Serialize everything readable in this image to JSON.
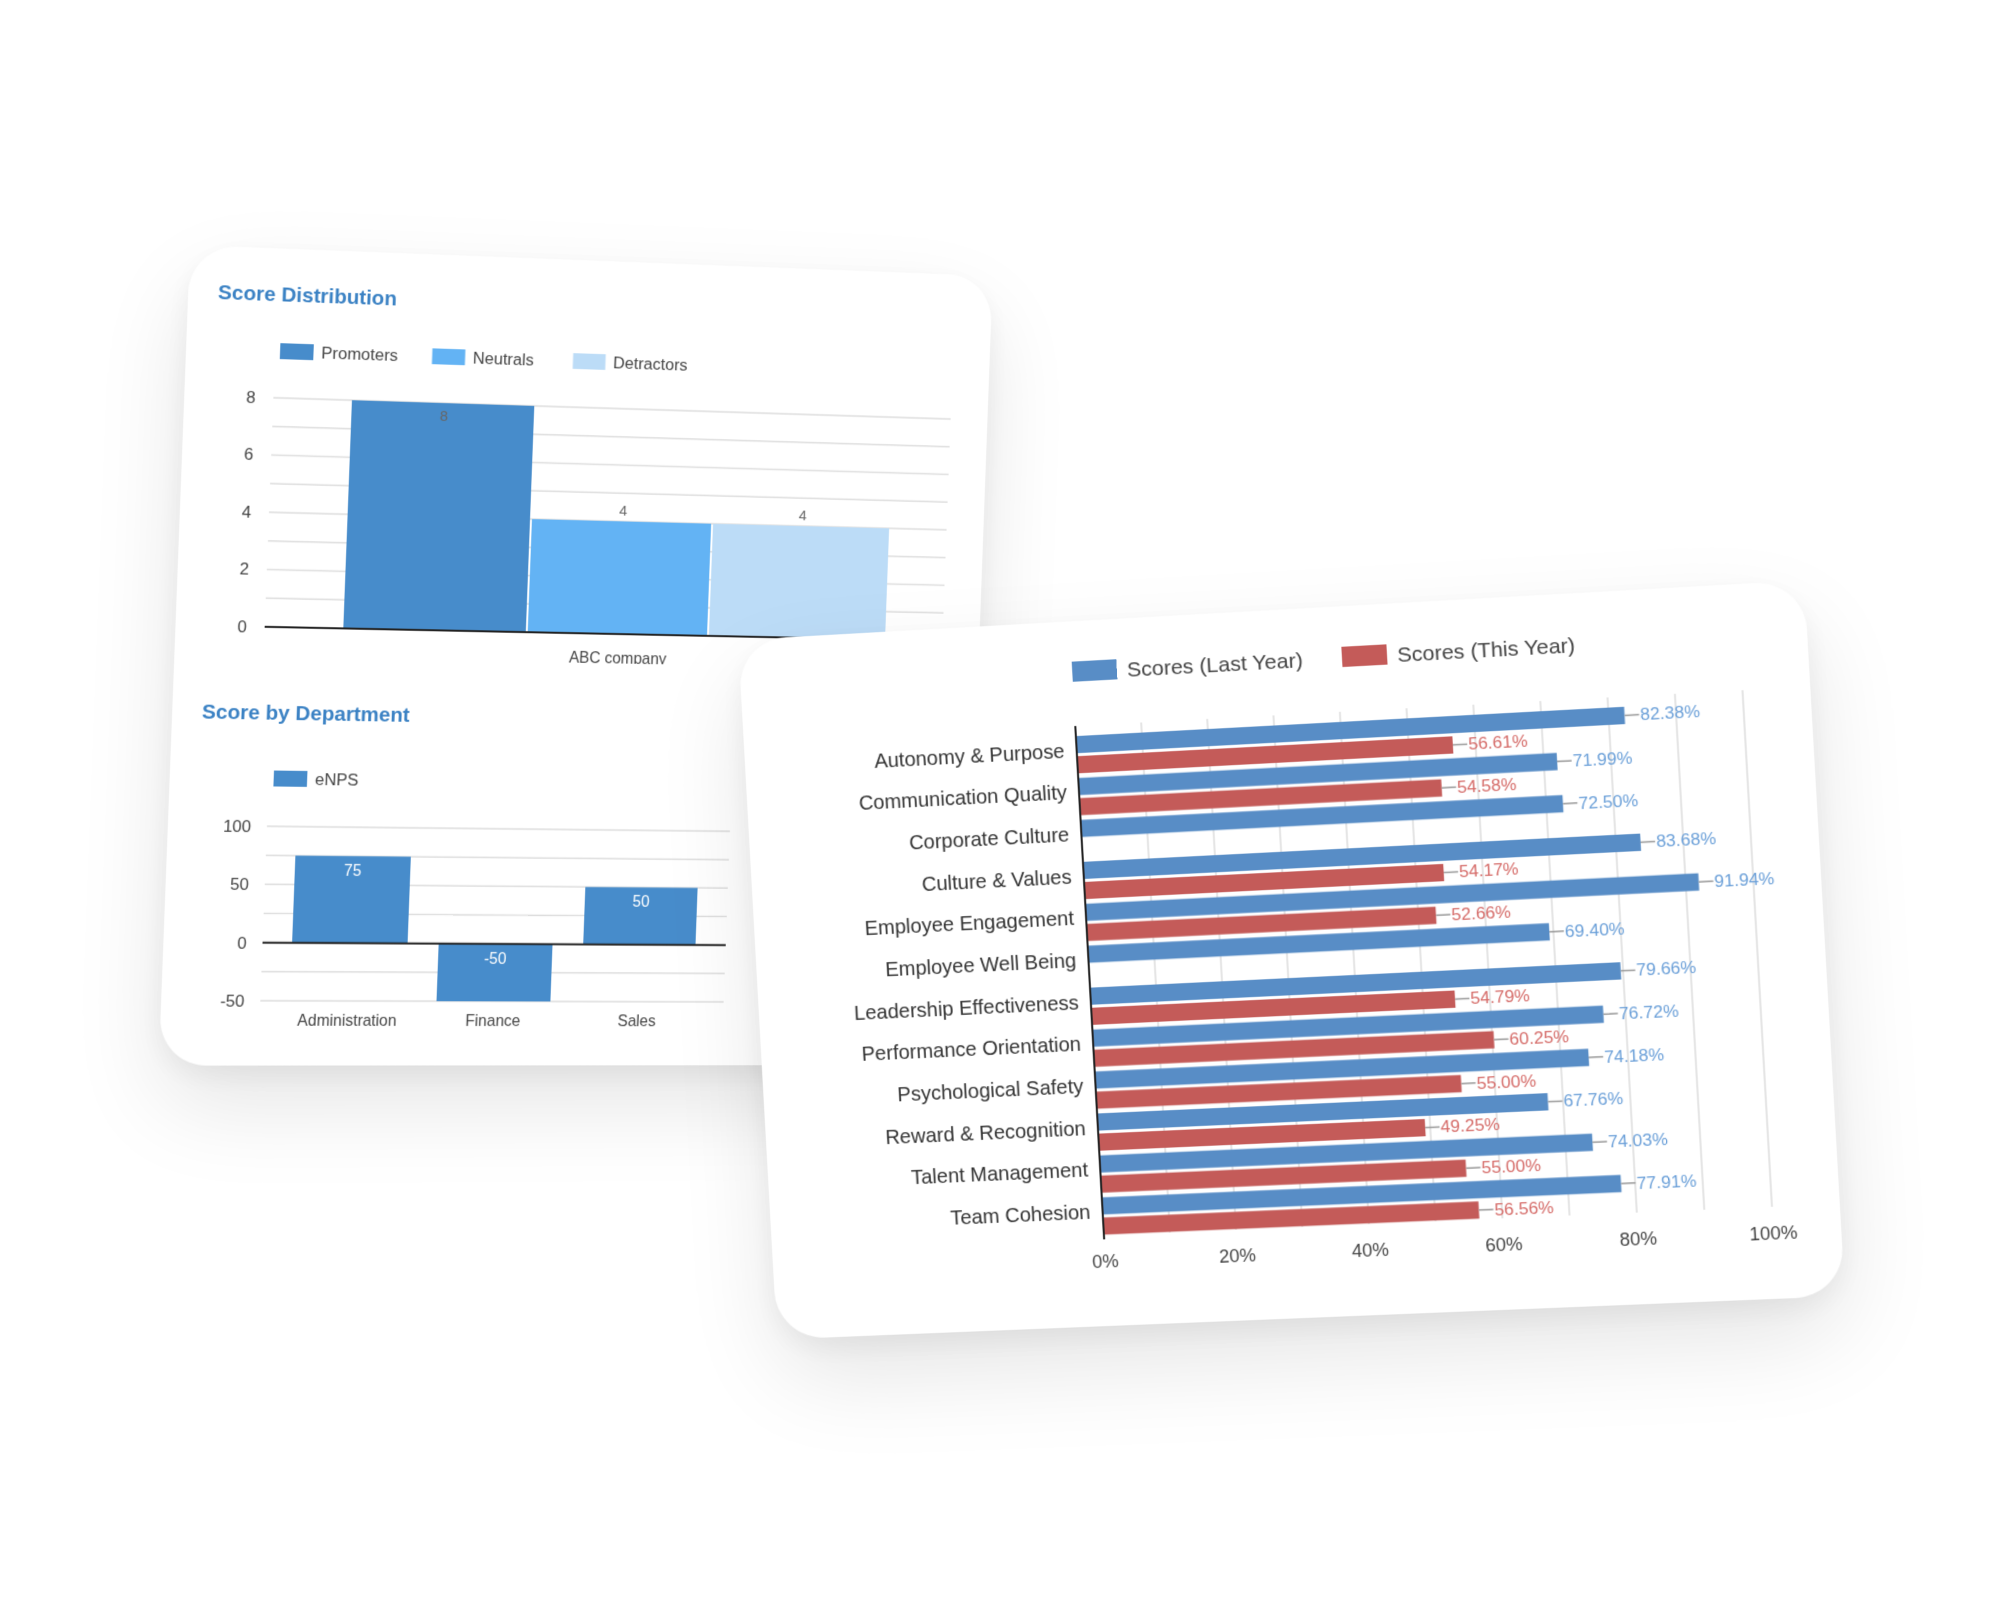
{
  "colors": {
    "promoters": "#478ccb",
    "neutrals": "#63b3f4",
    "detractors": "#bcdcf7",
    "enps": "#478ccb",
    "last_year": "#588dc6",
    "this_year": "#c45b59",
    "title": "#3b82c4",
    "axis_text": "#444444",
    "grid": "#dddddd"
  },
  "chart_data": [
    {
      "type": "bar",
      "title": "Score Distribution",
      "categories": [
        "ABC company"
      ],
      "series": [
        {
          "name": "Promoters",
          "values": [
            8
          ]
        },
        {
          "name": "Neutrals",
          "values": [
            4
          ]
        },
        {
          "name": "Detractors",
          "values": [
            4
          ]
        }
      ],
      "data_labels": [
        "8",
        "4",
        "4"
      ],
      "ylim": [
        0,
        8
      ],
      "yticks": [
        "0",
        "2",
        "4",
        "6",
        "8"
      ],
      "xlabel": "",
      "ylabel": "",
      "grid": true,
      "legend": "top-left"
    },
    {
      "type": "bar",
      "title": "Score by Department",
      "categories": [
        "Administration",
        "Finance",
        "Sales"
      ],
      "series": [
        {
          "name": "eNPS",
          "values": [
            75,
            -50,
            50
          ]
        }
      ],
      "data_labels": [
        "75",
        "-50",
        "50"
      ],
      "ylim": [
        -50,
        100
      ],
      "yticks": [
        "-50",
        "0",
        "50",
        "100"
      ],
      "xlabel": "",
      "ylabel": "",
      "grid": true,
      "legend": "top-left"
    },
    {
      "type": "bar",
      "orientation": "horizontal",
      "title": "",
      "categories": [
        "Autonomy & Purpose",
        "Communication Quality",
        "Corporate Culture",
        "Culture & Values",
        "Employee Engagement",
        "Employee Well Being",
        "Leadership Effectiveness",
        "Performance Orientation",
        "Psychological Safety",
        "Reward & Recognition",
        "Talent Management",
        "Team Cohesion"
      ],
      "series": [
        {
          "name": "Scores (Last Year)",
          "values": [
            82.38,
            71.99,
            72.5,
            83.68,
            91.94,
            69.4,
            79.66,
            76.72,
            74.18,
            67.76,
            74.03,
            77.91
          ],
          "labels": [
            "82.38%",
            "71.99%",
            "72.50%",
            "83.68%",
            "91.94%",
            "69.40%",
            "79.66%",
            "76.72%",
            "74.18%",
            "67.76%",
            "74.03%",
            "77.91%"
          ]
        },
        {
          "name": "Scores (This Year)",
          "values": [
            56.61,
            54.58,
            null,
            54.17,
            52.66,
            null,
            54.79,
            60.25,
            55.0,
            49.25,
            55.0,
            56.56
          ],
          "labels": [
            "56.61%",
            "54.58%",
            "",
            "54.17%",
            "52.66%",
            "",
            "54.79%",
            "60.25%",
            "55.00%",
            "49.25%",
            "55.00%",
            "56.56%"
          ]
        }
      ],
      "xlim": [
        0,
        100
      ],
      "xticks": [
        "0%",
        "20%",
        "40%",
        "60%",
        "80%",
        "100%"
      ],
      "xlabel": "",
      "ylabel": "",
      "grid": true,
      "legend": "top-center"
    }
  ]
}
